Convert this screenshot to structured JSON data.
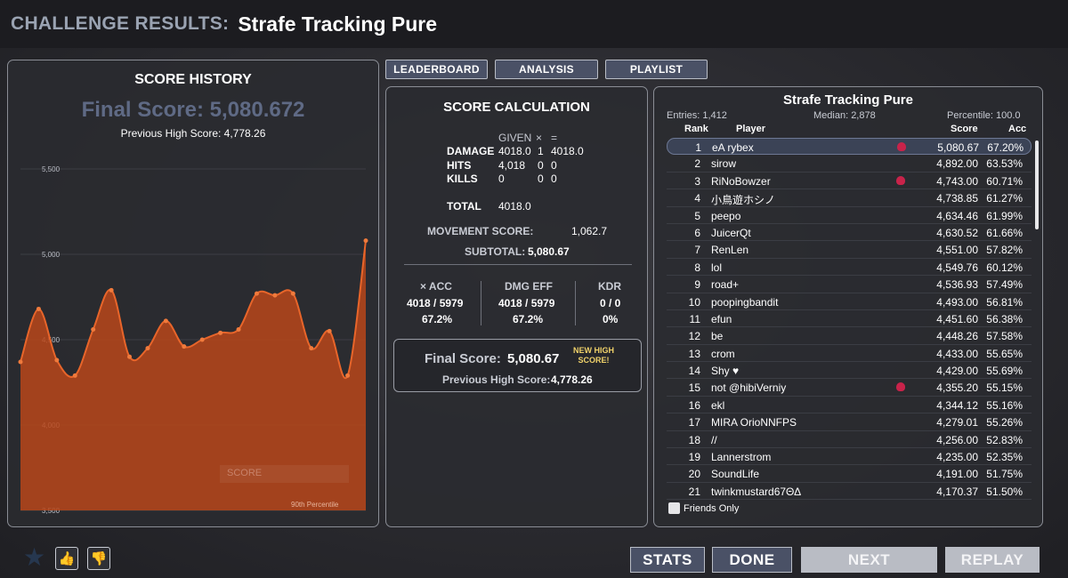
{
  "header": {
    "label": "CHALLENGE RESULTS:",
    "scenario": "Strafe Tracking Pure"
  },
  "history": {
    "title": "SCORE HISTORY",
    "final_score": "Final Score: 5,080.672",
    "previous_high": "Previous High Score: 4,778.26",
    "legend_score": "SCORE",
    "percentile_label": "90th Percentile"
  },
  "chart_data": {
    "type": "area",
    "title": "SCORE HISTORY",
    "y_ticks": [
      "5,500",
      "5,000",
      "4,500",
      "4,000",
      "3,500"
    ],
    "ylim": [
      3500,
      5500
    ],
    "values": [
      4370,
      4680,
      4380,
      4290,
      4560,
      4790,
      4400,
      4450,
      4610,
      4460,
      4500,
      4540,
      4560,
      4770,
      4760,
      4770,
      4450,
      4550,
      4290,
      5080
    ],
    "color": "#b8461a"
  },
  "tabs": [
    "LEADERBOARD",
    "ANALYSIS",
    "PLAYLIST"
  ],
  "calc": {
    "title": "SCORE CALCULATION",
    "given": "GIVEN",
    "times": "×",
    "equals": "=",
    "damage_label": "DAMAGE",
    "damage_given": "4018.0",
    "damage_mult": "1",
    "damage_result": "4018.0",
    "hits_label": "HITS",
    "hits_given": "4,018",
    "hits_mult": "0",
    "hits_result": "0",
    "kills_label": "KILLS",
    "kills_given": "0",
    "kills_mult": "0",
    "kills_result": "0",
    "total_label": "TOTAL",
    "total_value": "4018.0",
    "movement_label": "MOVEMENT SCORE:",
    "movement_value": "1,062.7",
    "subtotal_label": "SUBTOTAL:",
    "subtotal_value": "5,080.67",
    "acc_label": "× ACC",
    "acc_frac": "4018 / 5979",
    "acc_pct": "67.2%",
    "dmg_label": "DMG EFF",
    "dmg_frac": "4018 / 5979",
    "dmg_pct": "67.2%",
    "kdr_label": "KDR",
    "kdr_frac": "0 / 0",
    "kdr_pct": "0%",
    "final_label": "Final Score:",
    "final_value": "5,080.67",
    "new_high": "NEW HIGH SCORE!",
    "prev_label": "Previous High Score:",
    "prev_value": "4,778.26"
  },
  "board": {
    "title": "Strafe Tracking Pure",
    "entries": "Entries: 1,412",
    "median": "Median: 2,878",
    "percentile": "Percentile: 100.0",
    "col_rank": "Rank",
    "col_player": "Player",
    "col_score": "Score",
    "col_acc": "Acc",
    "friends_only": "Friends Only",
    "rows": [
      {
        "rank": "1",
        "player": "eA rybex",
        "score": "5,080.67",
        "acc": "67.20%",
        "badge": true
      },
      {
        "rank": "2",
        "player": "sirow",
        "score": "4,892.00",
        "acc": "63.53%",
        "badge": false
      },
      {
        "rank": "3",
        "player": "RiNoBowzer",
        "score": "4,743.00",
        "acc": "60.71%",
        "badge": true
      },
      {
        "rank": "4",
        "player": "小鳥遊ホシノ",
        "score": "4,738.85",
        "acc": "61.27%",
        "badge": false
      },
      {
        "rank": "5",
        "player": "peepo",
        "score": "4,634.46",
        "acc": "61.99%",
        "badge": false
      },
      {
        "rank": "6",
        "player": "JuicerQt",
        "score": "4,630.52",
        "acc": "61.66%",
        "badge": false
      },
      {
        "rank": "7",
        "player": "RenLen",
        "score": "4,551.00",
        "acc": "57.82%",
        "badge": false
      },
      {
        "rank": "8",
        "player": "lol",
        "score": "4,549.76",
        "acc": "60.12%",
        "badge": false
      },
      {
        "rank": "9",
        "player": "road+",
        "score": "4,536.93",
        "acc": "57.49%",
        "badge": false
      },
      {
        "rank": "10",
        "player": "poopingbandit",
        "score": "4,493.00",
        "acc": "56.81%",
        "badge": false
      },
      {
        "rank": "11",
        "player": "efun",
        "score": "4,451.60",
        "acc": "56.38%",
        "badge": false
      },
      {
        "rank": "12",
        "player": "be",
        "score": "4,448.26",
        "acc": "57.58%",
        "badge": false
      },
      {
        "rank": "13",
        "player": "crom",
        "score": "4,433.00",
        "acc": "55.65%",
        "badge": false
      },
      {
        "rank": "14",
        "player": "Shy ♥",
        "score": "4,429.00",
        "acc": "55.69%",
        "badge": false
      },
      {
        "rank": "15",
        "player": "not @hibiVerniy",
        "score": "4,355.20",
        "acc": "55.15%",
        "badge": true
      },
      {
        "rank": "16",
        "player": "ekl",
        "score": "4,344.12",
        "acc": "55.16%",
        "badge": false
      },
      {
        "rank": "17",
        "player": "MIRA OrioNNFPS",
        "score": "4,279.01",
        "acc": "55.26%",
        "badge": false
      },
      {
        "rank": "18",
        "player": "//",
        "score": "4,256.00",
        "acc": "52.83%",
        "badge": false
      },
      {
        "rank": "19",
        "player": "Lannerstrom",
        "score": "4,235.00",
        "acc": "52.35%",
        "badge": false
      },
      {
        "rank": "20",
        "player": "SoundLife",
        "score": "4,191.00",
        "acc": "51.75%",
        "badge": false
      },
      {
        "rank": "21",
        "player": "twinkmustard67ΘΔ",
        "score": "4,170.37",
        "acc": "51.50%",
        "badge": false
      }
    ]
  },
  "buttons": {
    "stats": "STATS",
    "done": "DONE",
    "next": "NEXT",
    "replay": "REPLAY"
  },
  "icons": {
    "favorite": "star-icon",
    "like": "thumbs-up-icon",
    "dislike": "thumbs-down-icon"
  }
}
